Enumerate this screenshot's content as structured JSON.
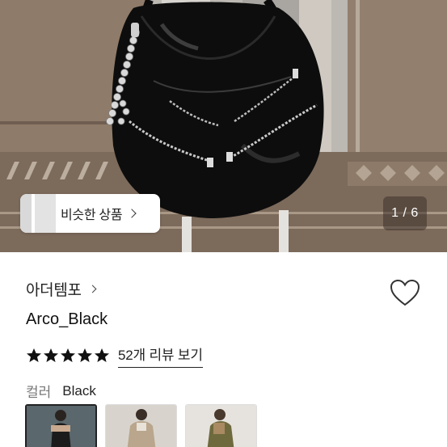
{
  "hero": {
    "similar_button_label": "비슷한 상품",
    "image_counter": "1 / 6"
  },
  "product": {
    "brand": "아더템포",
    "title": "Arco_Black",
    "rating_stars": 5,
    "review_link": "52개 리뷰 보기"
  },
  "options": {
    "label": "컬러",
    "selected_value": "Black",
    "swatches": [
      {
        "name": "black"
      },
      {
        "name": "beige"
      },
      {
        "name": "olive"
      }
    ]
  },
  "colors": {
    "star": "#111111",
    "heart_outline": "#333333",
    "counter_bg": "rgba(60,50,42,0.55)"
  }
}
